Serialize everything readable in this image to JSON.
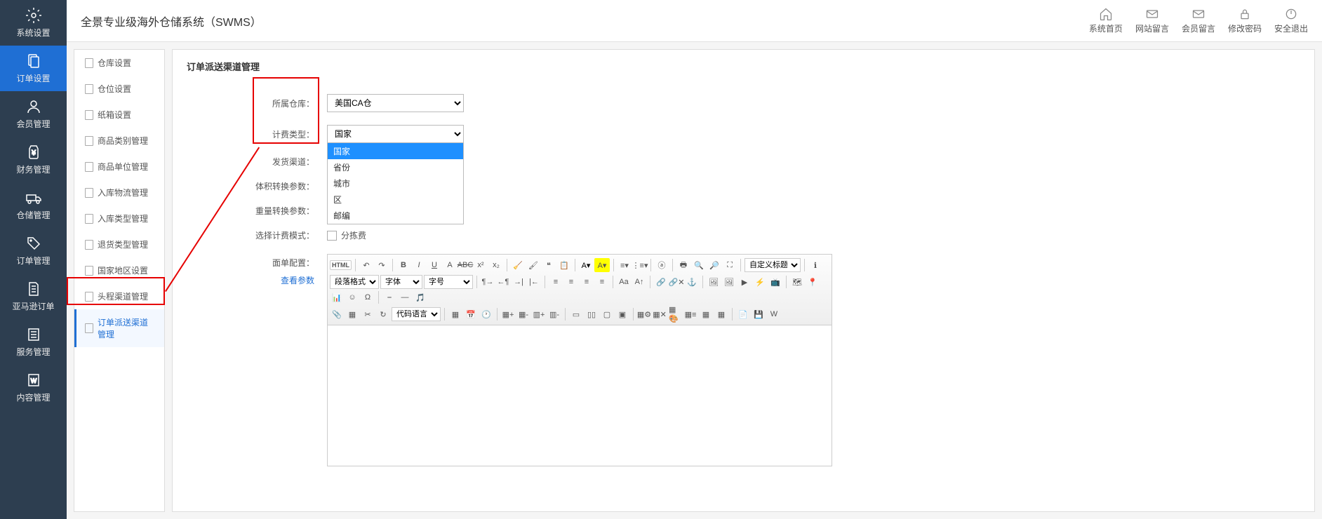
{
  "header": {
    "title": "全景专业级海外仓储系统（SWMS）",
    "actions": [
      {
        "name": "home",
        "label": "系统首页"
      },
      {
        "name": "site-msg",
        "label": "网站留言"
      },
      {
        "name": "member-msg",
        "label": "会员留言"
      },
      {
        "name": "password",
        "label": "修改密码"
      },
      {
        "name": "logout",
        "label": "安全退出"
      }
    ]
  },
  "sidebar_main": [
    {
      "name": "system-settings",
      "label": "系统设置"
    },
    {
      "name": "order-settings",
      "label": "订单设置"
    },
    {
      "name": "member-manage",
      "label": "会员管理"
    },
    {
      "name": "finance-manage",
      "label": "财务管理"
    },
    {
      "name": "storage-manage",
      "label": "仓储管理"
    },
    {
      "name": "order-manage",
      "label": "订单管理"
    },
    {
      "name": "amazon-order",
      "label": "亚马逊订单"
    },
    {
      "name": "service-manage",
      "label": "服务管理"
    },
    {
      "name": "content-manage",
      "label": "内容管理"
    }
  ],
  "sidebar_sub": [
    {
      "label": "仓库设置"
    },
    {
      "label": "仓位设置"
    },
    {
      "label": "纸箱设置"
    },
    {
      "label": "商品类别管理"
    },
    {
      "label": "商品单位管理"
    },
    {
      "label": "入库物流管理"
    },
    {
      "label": "入库类型管理"
    },
    {
      "label": "退货类型管理"
    },
    {
      "label": "国家地区设置"
    },
    {
      "label": "头程渠道管理"
    },
    {
      "label": "订单派送渠道管理"
    }
  ],
  "page": {
    "title": "订单派送渠道管理",
    "form": {
      "warehouse_label": "所属仓库：",
      "warehouse_value": "美国CA仓",
      "fee_type_label": "计费类型：",
      "fee_type_value": "国家",
      "ship_channel_label": "发货渠道：",
      "volume_label": "体积转换参数：",
      "weight_label": "重量转换参数：",
      "mode_label": "选择计费模式：",
      "mode_option": "分拣费",
      "template_label": "面单配置：",
      "view_params": "查看参数"
    },
    "fee_type_options": [
      "国家",
      "省份",
      "城市",
      "区",
      "邮编"
    ]
  },
  "editor": {
    "para_label": "段落格式",
    "font_label": "字体",
    "size_label": "字号",
    "heading_label": "自定义标题",
    "code_label": "代码语言"
  }
}
